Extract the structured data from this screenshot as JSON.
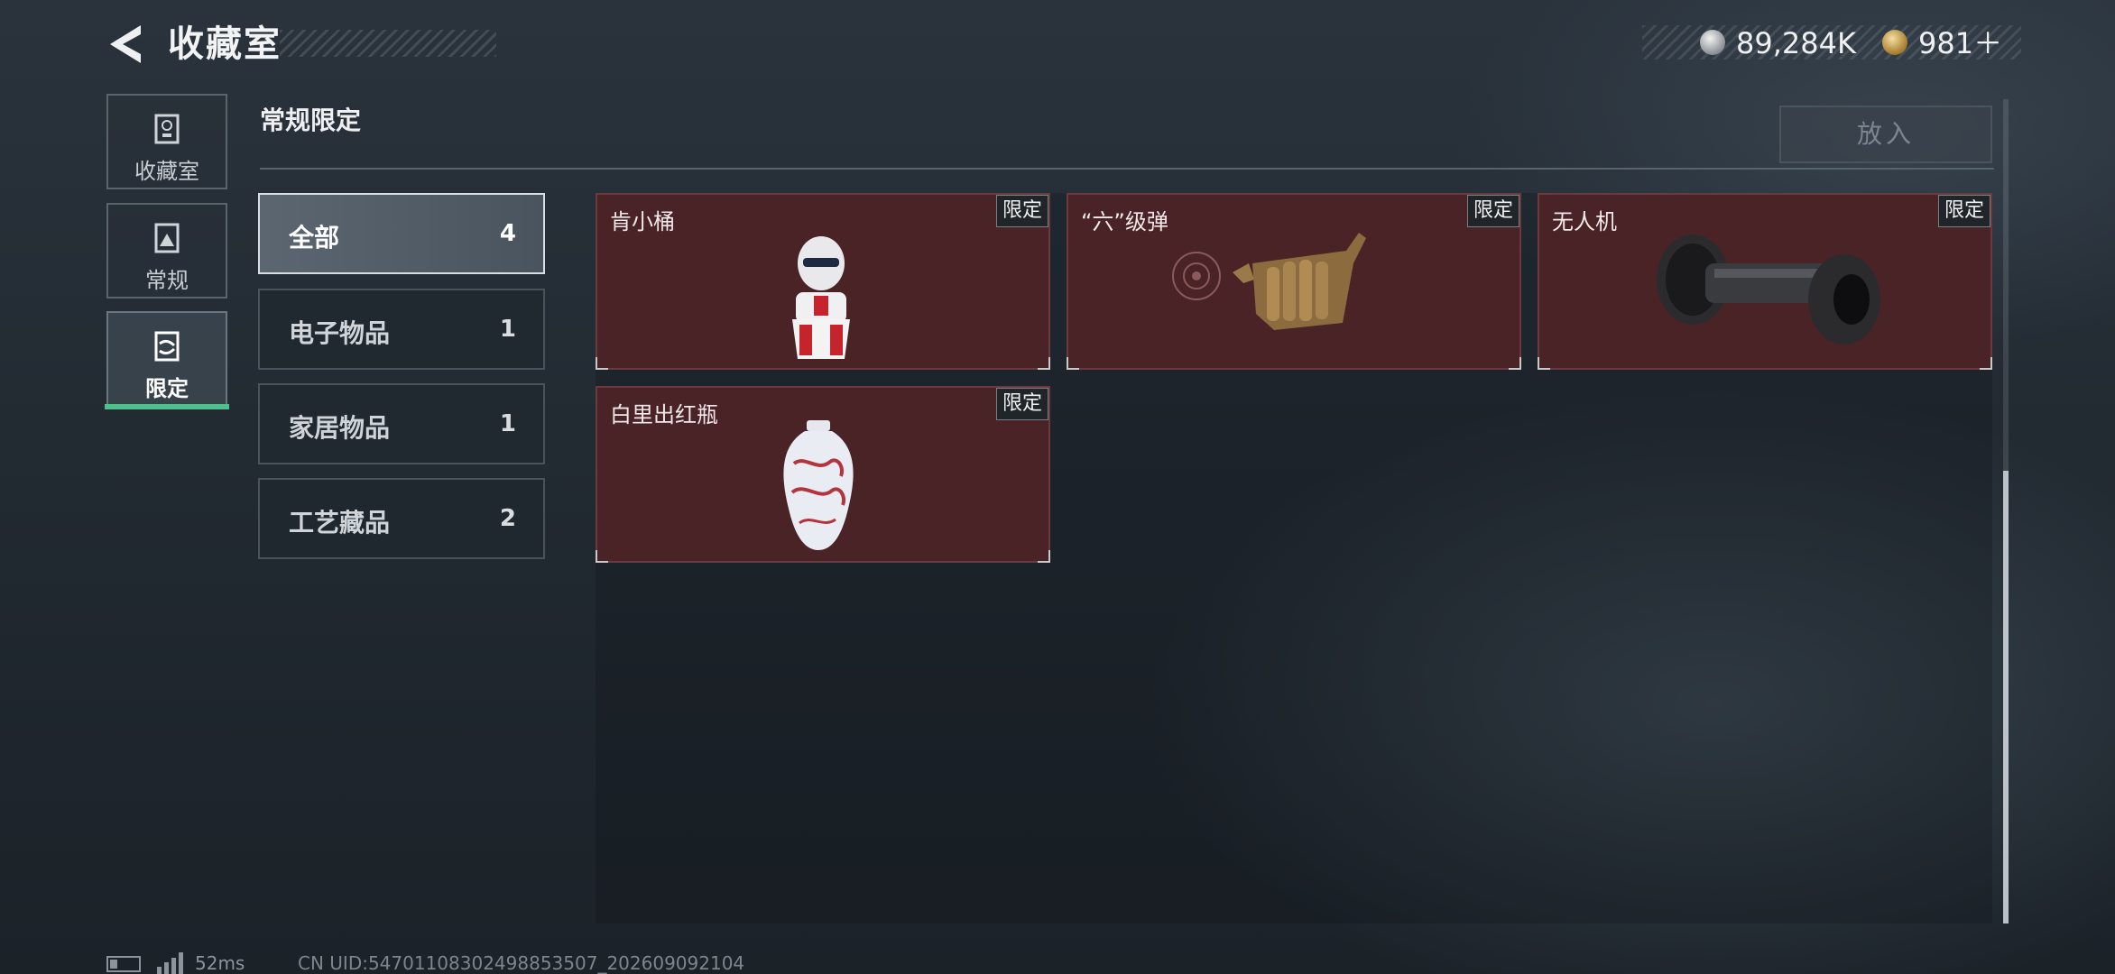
{
  "header": {
    "title": "收藏室",
    "currency_1": {
      "icon": "silver-coin-icon",
      "value": "89,284K"
    },
    "currency_2": {
      "icon": "gold-triangle-coin-icon",
      "value": "981＋"
    }
  },
  "nav": {
    "items": [
      {
        "label": "收藏室",
        "icon": "trophy-icon"
      },
      {
        "label": "常规",
        "icon": "framed-picture-icon"
      },
      {
        "label": "限定",
        "icon": "limited-picture-icon",
        "active": true
      }
    ]
  },
  "section": {
    "title": "常规限定",
    "put_button": "放入"
  },
  "categories": [
    {
      "label": "全部",
      "count": "4",
      "active": true
    },
    {
      "label": "电子物品",
      "count": "1"
    },
    {
      "label": "家居物品",
      "count": "1"
    },
    {
      "label": "工艺藏品",
      "count": "2"
    }
  ],
  "items": [
    {
      "name": "肯小桶",
      "badge": "限定",
      "icon": "kfc-bucket-figure-icon"
    },
    {
      "name": "“六”级弹",
      "badge": "限定",
      "icon": "bullet-hand-sculpture-icon"
    },
    {
      "name": "无人机",
      "badge": "限定",
      "icon": "drone-wheel-icon"
    },
    {
      "name": "白里出红瓶",
      "badge": "限定",
      "icon": "porcelain-vase-icon"
    }
  ],
  "colors": {
    "accent": "#4fc08d",
    "card_bg": "#4a2327"
  },
  "footer": {
    "ping": "52ms",
    "uid": "CN UID:54701108302498853507_202609092104"
  }
}
